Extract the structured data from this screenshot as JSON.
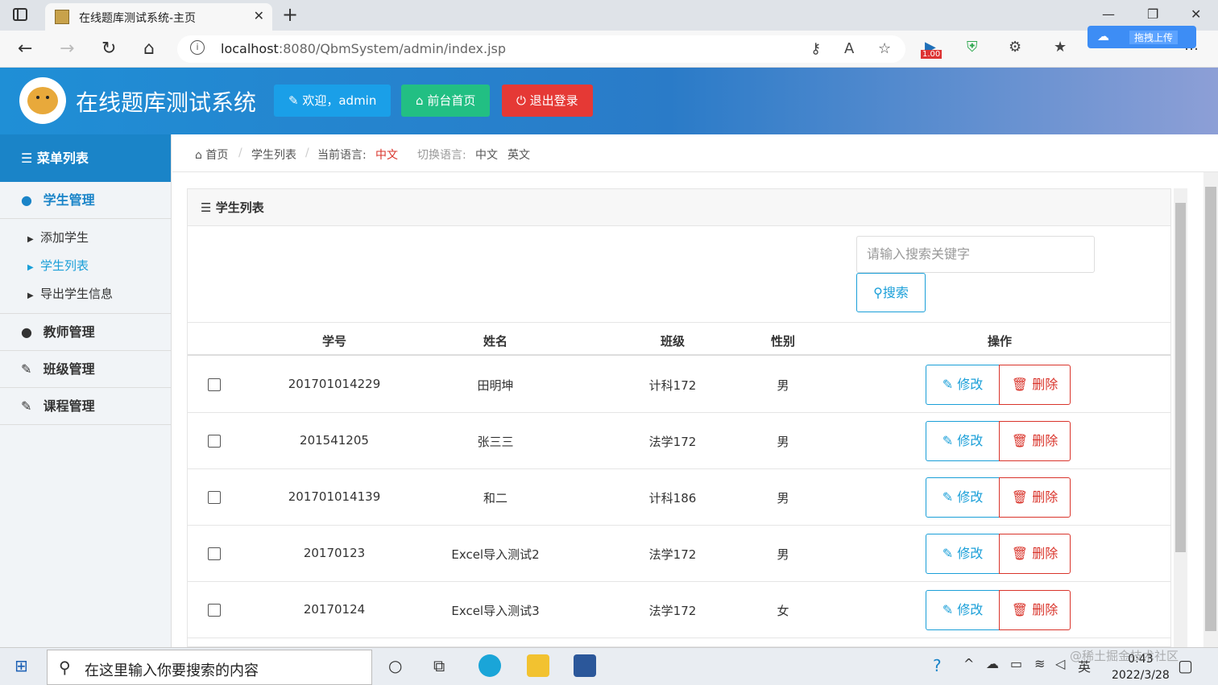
{
  "browser": {
    "tab_title": "在线题库测试系统-主页",
    "tab_close": "✕",
    "new_tab": "+",
    "url_host": "localhost",
    "url_rest": ":8080/QbmSystem/admin/index.jsp",
    "cloud_upload_label": "拖拽上传",
    "ext_version": "1.00"
  },
  "header": {
    "app_title": "在线题库测试系统",
    "welcome_label": "欢迎，admin",
    "front_home_label": "前台首页",
    "logout_label": "退出登录",
    "colors": {
      "welcome": "#1a9fe8",
      "front_home": "#22bf83",
      "logout": "#e53935"
    }
  },
  "sidebar": {
    "menu_title": "菜单列表",
    "groups": [
      {
        "label": "学生管理",
        "active": true,
        "items": [
          {
            "label": "添加学生"
          },
          {
            "label": "学生列表",
            "active": true
          },
          {
            "label": "导出学生信息"
          }
        ]
      },
      {
        "label": "教师管理"
      },
      {
        "label": "班级管理"
      },
      {
        "label": "课程管理"
      }
    ]
  },
  "breadcrumb": {
    "home": "首页",
    "current": "学生列表",
    "lang_prefix": "当前语言:",
    "lang_current": "中文",
    "switch_prefix": "切换语言:",
    "switch_zh": "中文",
    "switch_en": "英文"
  },
  "panel": {
    "title": "学生列表",
    "search_placeholder": "请输入搜索关键字",
    "search_button": "搜索",
    "columns": [
      "学号",
      "姓名",
      "班级",
      "性别",
      "操作"
    ],
    "rows": [
      {
        "id": "201701014229",
        "name": "田明坤",
        "class": "计科172",
        "gender": "男"
      },
      {
        "id": "201541205",
        "name": "张三三",
        "class": "法学172",
        "gender": "男"
      },
      {
        "id": "201701014139",
        "name": "和二",
        "class": "计科186",
        "gender": "男"
      },
      {
        "id": "20170123",
        "name": "Excel导入测试2",
        "class": "法学172",
        "gender": "男"
      },
      {
        "id": "20170124",
        "name": "Excel导入测试3",
        "class": "法学172",
        "gender": "女"
      }
    ],
    "edit_label": "修改",
    "delete_label": "删除"
  },
  "taskbar": {
    "search_placeholder": "在这里输入你要搜索的内容",
    "ime": "英",
    "time": "0:43",
    "date": "2022/3/28",
    "watermark": "@稀土掘金技术社区"
  }
}
